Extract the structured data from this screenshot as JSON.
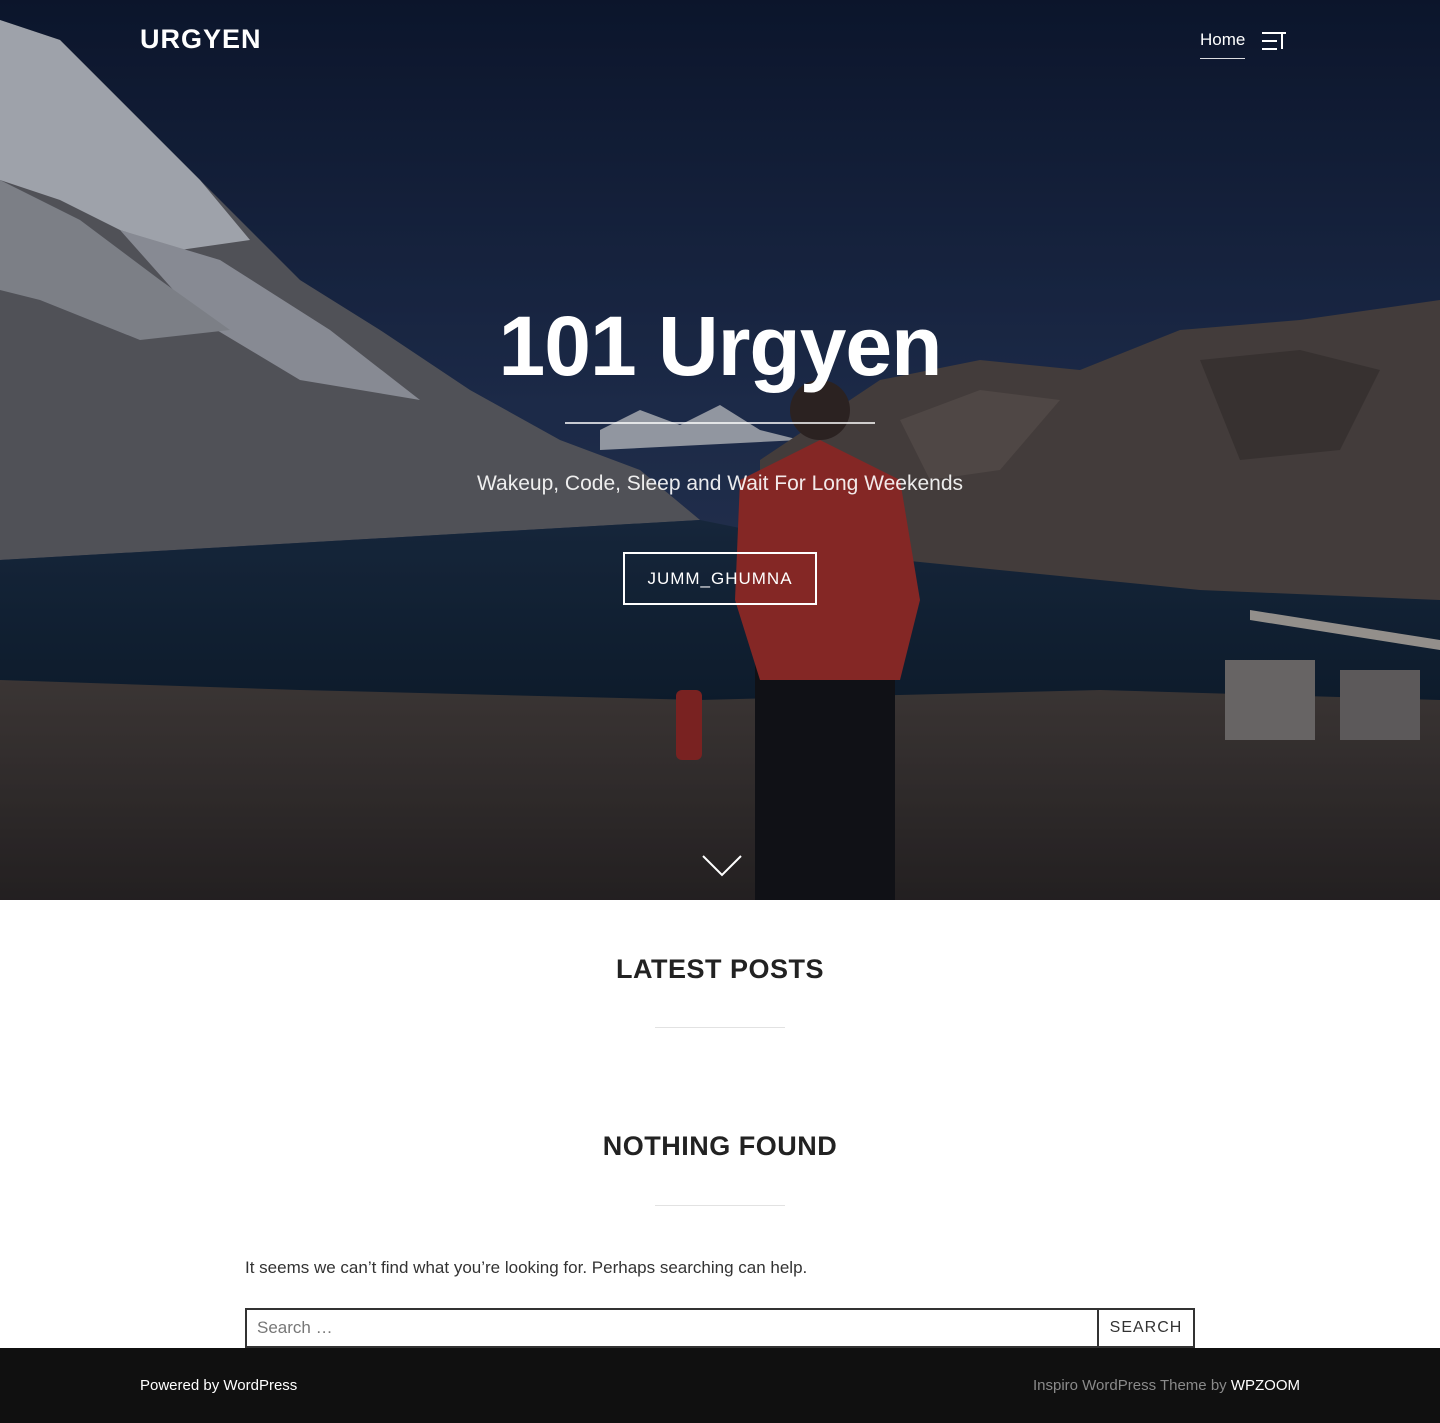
{
  "header": {
    "site_title": "URGYEN",
    "nav_home": "Home"
  },
  "hero": {
    "title": "101 Urgyen",
    "tagline": "Wakeup, Code, Sleep and Wait For Long Weekends",
    "button_label": "JUMM_GHUMNA"
  },
  "latest_posts": {
    "title": "LATEST POSTS"
  },
  "nothing_found": {
    "title": "NOTHING FOUND",
    "message": "It seems we can’t find what you’re looking for. Perhaps searching can help."
  },
  "search": {
    "placeholder": "Search …",
    "button_label": "SEARCH"
  },
  "footer": {
    "powered_by": "Powered by WordPress",
    "theme_text": "Inspiro WordPress Theme by",
    "theme_link": "WPZOOM"
  },
  "icons": {
    "menu": "menu-toggle-icon",
    "scroll": "chevron-down-icon"
  },
  "colors": {
    "footer_bg": "#101010",
    "text_dark": "#222222",
    "jacket_red": "#b5322a"
  }
}
